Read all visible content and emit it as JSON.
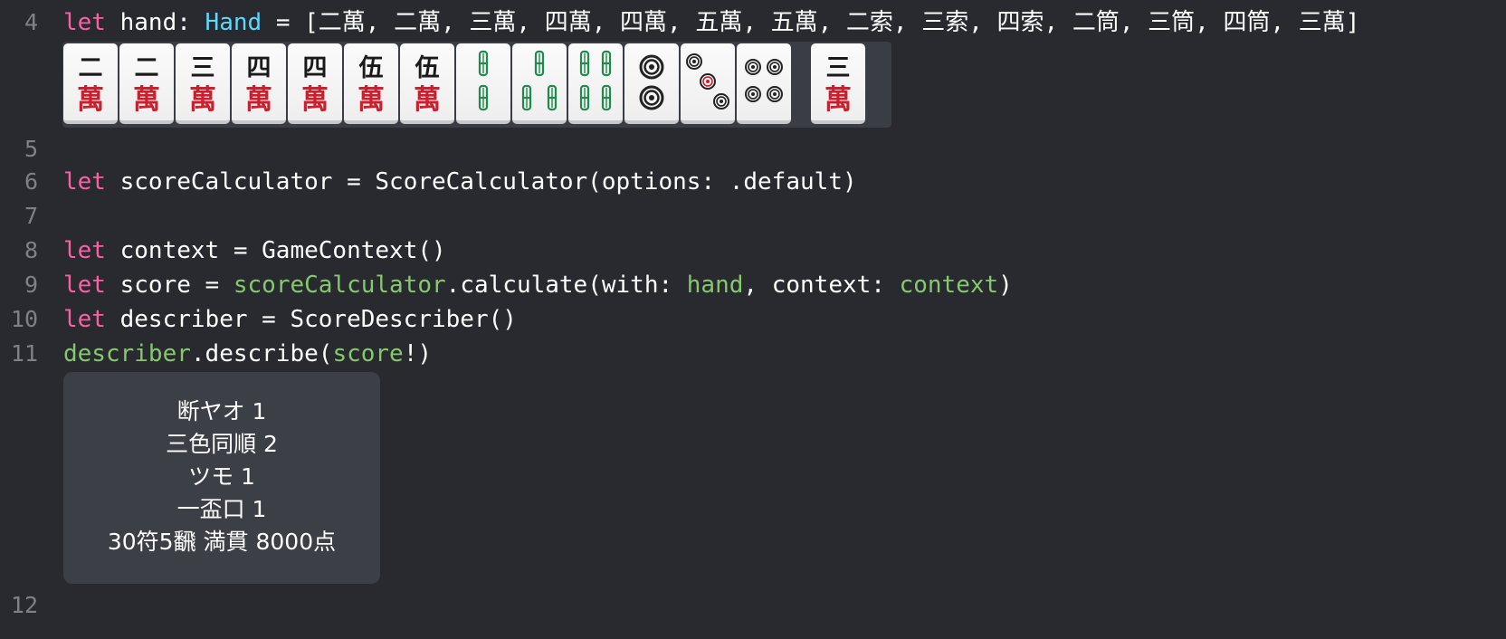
{
  "lines": {
    "l4": {
      "num": "4",
      "kw": "let",
      "name": " hand: ",
      "type": "Hand",
      "rest": " = [二萬, 二萬, 三萬, 四萬, 四萬, 五萬, 五萬, 二索, 三索, 四索, 二筒, 三筒, 四筒, 三萬]"
    },
    "l5": {
      "num": "5"
    },
    "l6": {
      "num": "6",
      "kw": "let",
      "rest": " scoreCalculator = ScoreCalculator(options: .default)"
    },
    "l7": {
      "num": "7"
    },
    "l8": {
      "num": "8",
      "kw": "let",
      "rest": " context = GameContext()"
    },
    "l9": {
      "num": "9",
      "kw": "let",
      "a": " score = ",
      "v1": "scoreCalculator",
      "b": ".calculate(with: ",
      "v2": "hand",
      "c": ", context: ",
      "v3": "context",
      "d": ")"
    },
    "l10": {
      "num": "10",
      "kw": "let",
      "rest": " describer = ScoreDescriber()"
    },
    "l11": {
      "num": "11",
      "v1": "describer",
      "a": ".describe(",
      "v2": "score",
      "b": "!)"
    },
    "l12": {
      "num": "12"
    }
  },
  "tiles": [
    {
      "suit": "man",
      "top": "二",
      "bottom": "萬"
    },
    {
      "suit": "man",
      "top": "二",
      "bottom": "萬"
    },
    {
      "suit": "man",
      "top": "三",
      "bottom": "萬"
    },
    {
      "suit": "man",
      "top": "四",
      "bottom": "萬"
    },
    {
      "suit": "man",
      "top": "四",
      "bottom": "萬"
    },
    {
      "suit": "man",
      "top": "伍",
      "bottom": "萬"
    },
    {
      "suit": "man",
      "top": "伍",
      "bottom": "萬"
    },
    {
      "suit": "sou",
      "count": 2
    },
    {
      "suit": "sou",
      "count": 3
    },
    {
      "suit": "sou",
      "count": 4
    },
    {
      "suit": "pin",
      "count": 2
    },
    {
      "suit": "pin",
      "count": 3
    },
    {
      "suit": "pin",
      "count": 4
    },
    {
      "suit": "man",
      "top": "三",
      "bottom": "萬",
      "drawn": true
    }
  ],
  "result": {
    "lines": [
      "断ヤオ 1",
      "三色同順 2",
      "ツモ 1",
      "一盃口 1",
      "30符5飜 満貫 8000点"
    ]
  },
  "colors": {
    "background": "#292a30",
    "keyword": "#fc5fa3",
    "type": "#5dd8ff",
    "variable": "#84c96c",
    "line_number": "#7f8088",
    "man_red": "#c8202e",
    "sou_green": "#1f8a4c"
  }
}
